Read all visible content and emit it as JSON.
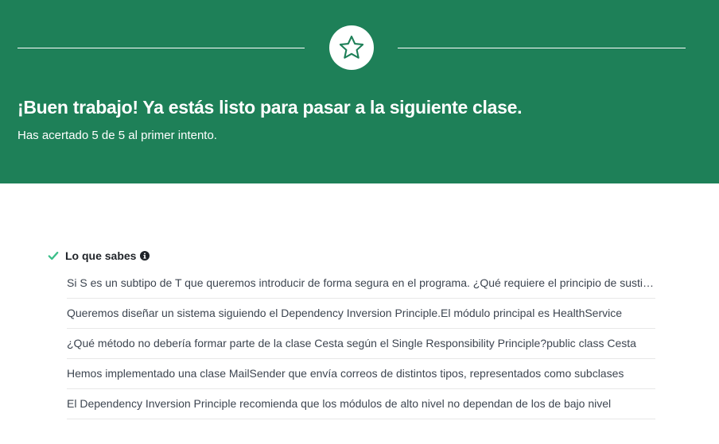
{
  "hero": {
    "badge_icon": "star-icon",
    "title": "¡Buen trabajo! Ya estás listo para pasar a la siguiente clase.",
    "subtitle": "Has acertado 5 de 5 al primer intento.",
    "background_color": "#1e8058"
  },
  "knowledge": {
    "status_icon": "check-icon",
    "title": "Lo que sabes",
    "info_icon": "info-icon",
    "accent_color": "#3bbf8a",
    "questions": [
      "Si S es un subtipo de T que queremos introducir de forma segura en el programa. ¿Qué requiere el principio de sustitución de Liskov?",
      "Queremos diseñar un sistema siguiendo el Dependency Inversion Principle.El módulo principal es HealthService",
      "¿Qué método no debería formar parte de la clase Cesta según el Single Responsibility Principle?public class Cesta",
      "Hemos implementado una clase MailSender que envía correos de distintos tipos, representados como subclases",
      "El Dependency Inversion Principle recomienda que los módulos de alto nivel no dependan de los de bajo nivel"
    ]
  }
}
